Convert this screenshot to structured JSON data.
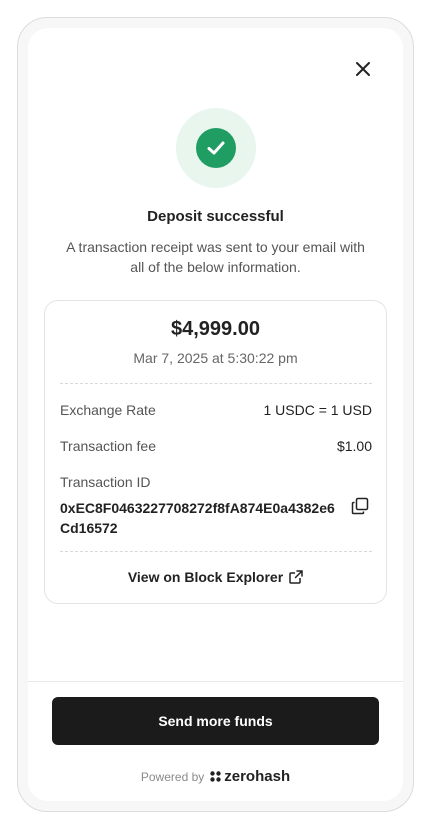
{
  "header": {
    "close_icon": "close-icon"
  },
  "status": {
    "icon": "check-circle-icon",
    "accent_color": "#1f9d63",
    "title": "Deposit successful",
    "subtitle": "A transaction receipt was sent to your email with all of the below information."
  },
  "receipt": {
    "amount": "$4,999.00",
    "date": "Mar 7, 2025 at 5:30:22 pm",
    "exchange_rate_label": "Exchange Rate",
    "exchange_rate_value": "1 USDC = 1 USD",
    "fee_label": "Transaction fee",
    "fee_value": "$1.00",
    "txid_label": "Transaction ID",
    "txid_value": "0xEC8F0463227708272f8fA874E0a4382e6Cd16572",
    "copy_icon": "copy-icon",
    "explorer_link": "View on Block Explorer",
    "external_icon": "external-link-icon"
  },
  "footer": {
    "cta_label": "Send more funds",
    "powered_by": "Powered by",
    "brand_name": "zerohash",
    "brand_icon": "zerohash-logo-icon"
  }
}
